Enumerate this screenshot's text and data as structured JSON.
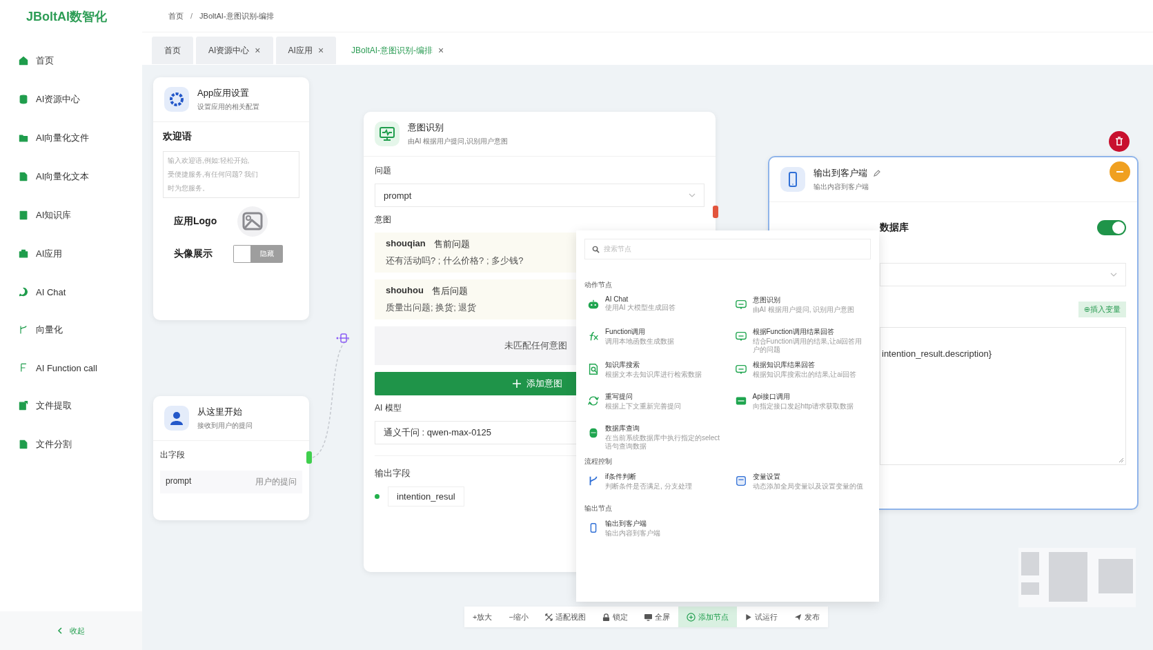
{
  "brand": "JBoltAI数智化",
  "breadcrumb": {
    "items": [
      "首页",
      "JBoltAI-意图识别-编排"
    ],
    "separator": "/"
  },
  "sidebar": {
    "items": [
      {
        "label": "首页"
      },
      {
        "label": "AI资源中心"
      },
      {
        "label": "AI向量化文件"
      },
      {
        "label": "AI向量化文本"
      },
      {
        "label": "AI知识库"
      },
      {
        "label": "AI应用"
      },
      {
        "label": "AI Chat"
      },
      {
        "label": "向量化"
      },
      {
        "label": "AI Function call"
      },
      {
        "label": "文件提取"
      },
      {
        "label": "文件分割"
      }
    ],
    "collapse": "收起"
  },
  "tabs": [
    {
      "label": "首页",
      "selected": false
    },
    {
      "label": "AI资源中心",
      "close": "×",
      "selected": false
    },
    {
      "label": "AI应用",
      "close": "×",
      "selected": false
    },
    {
      "label": "JBoltAI-意图识别-编排",
      "close": "×",
      "selected": true
    }
  ],
  "app_settings_node": {
    "title": "App应用设置",
    "subtitle": "设置应用的相关配置",
    "welcome_label": "欢迎语",
    "welcome_placeholder": [
      "输入欢迎语,例如:轻松开始,",
      "受便捷服务,有任何问题? 我们",
      "时为您服务。"
    ],
    "logo_label": "应用Logo",
    "avatar": {
      "label": "头像展示",
      "on": false,
      "text": "隐藏"
    }
  },
  "start_node": {
    "title": "从这里开始",
    "subtitle": "接收到用户的提问",
    "fields_label": "出字段",
    "fields": [
      {
        "name": "prompt",
        "description": "用户的提问"
      }
    ]
  },
  "intent_node": {
    "title": "意图识别",
    "subtitle": "由AI 根据用户提问,识别用户意图",
    "question_label": "问题",
    "question_value": "prompt",
    "intents_label": "意图",
    "intents": [
      {
        "key": "shouqian",
        "name": "售前问题",
        "examples": "还有活动吗? ; 什么价格? ; 多少钱?"
      },
      {
        "key": "shouhou",
        "name": "售后问题",
        "examples": "质量出问题; 换货; 退货"
      }
    ],
    "unmatched": "未匹配任何意图",
    "add_button": "添加意图",
    "model_label": "AI 模型",
    "model_value": "通义千问 : qwen-max-0125",
    "output_label": "输出字段",
    "outputs": [
      "intention_resul"
    ]
  },
  "output_node": {
    "title": "输出到客户端",
    "subtitle": "输出内容到客户端",
    "db_label": "数据库",
    "db_toggle": {
      "on": true
    },
    "insert_button": "⊕插入变量",
    "content": "intention_result.description}"
  },
  "node_menu": {
    "search_placeholder": "搜索节点",
    "sections": [
      {
        "title": "动作节点",
        "items": [
          {
            "title": "AI Chat",
            "description": "使用AI 大模型生成回答"
          },
          {
            "title": "意图识别",
            "description": "由AI 根据用户提问, 识别用户意图"
          },
          {
            "title": "Function调用",
            "description": "调用本地函数生成数据"
          },
          {
            "title": "根据Function调用结果回答",
            "description": "结合Function调用的结果,让ai回答用户的问题"
          },
          {
            "title": "知识库搜索",
            "description": "根据文本去知识库进行检索数据"
          },
          {
            "title": "根据知识库结果回答",
            "description": "根据知识库搜索出的结果,让ai回答"
          },
          {
            "title": "重写提问",
            "description": "根据上下文重新完善提问"
          },
          {
            "title": "Api接口调用",
            "description": "向指定接口发起http请求获取数据"
          },
          {
            "title": "数据库查询",
            "description": "在当前系统数据库中执行指定的select语句查询数据"
          }
        ]
      },
      {
        "title": "流程控制",
        "items": [
          {
            "title": "if条件判断",
            "description": "判断条件是否满足, 分支处理"
          },
          {
            "title": "变量设置",
            "description": "动态添加全局变量以及设置变量的值"
          }
        ]
      },
      {
        "title": "输出节点",
        "items": [
          {
            "title": "输出到客户端",
            "description": "输出内容到客户端"
          }
        ]
      }
    ]
  },
  "toolbar": [
    {
      "label": "+放大",
      "selected": false
    },
    {
      "label": "−缩小",
      "selected": false
    },
    {
      "label": "适配视图",
      "selected": false
    },
    {
      "label": "锁定",
      "selected": false
    },
    {
      "label": "全屏",
      "selected": false
    },
    {
      "label": "添加节点",
      "selected": true
    },
    {
      "label": "试运行",
      "selected": false
    },
    {
      "label": "发布",
      "selected": false
    }
  ]
}
